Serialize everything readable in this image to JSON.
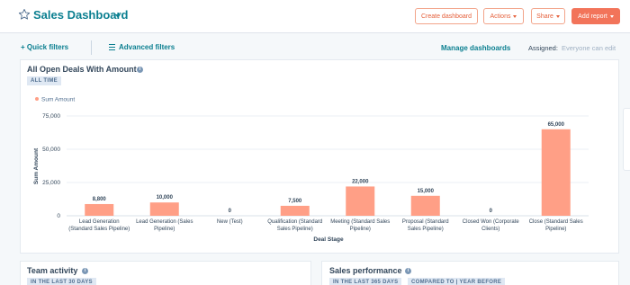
{
  "header": {
    "title": "Sales Dashboard",
    "buttons": {
      "create_dashboard": "Create dashboard",
      "actions": "Actions",
      "share": "Share",
      "add_report": "Add report"
    }
  },
  "filters": {
    "quick_filters": "+ Quick filters",
    "advanced_filters": "Advanced filters",
    "manage_dashboards": "Manage dashboards",
    "assigned_label": "Assigned:",
    "assigned_value": "Everyone can edit"
  },
  "report": {
    "title": "All Open Deals With Amount",
    "time_tag": "ALL TIME"
  },
  "chart_data": {
    "type": "bar",
    "title": "All Open Deals With Amount",
    "categories": [
      [
        "Lead Generation",
        "(Standard Sales Pipeline)"
      ],
      [
        "Lead Generation (Sales",
        "Pipeline)"
      ],
      [
        "New (Test)"
      ],
      [
        "Qualification (Standard",
        "Sales Pipeline)"
      ],
      [
        "Meeting (Standard Sales",
        "Pipeline)"
      ],
      [
        "Proposal (Standard",
        "Sales Pipeline)"
      ],
      [
        "Closed Won (Corporate",
        "Clients)"
      ],
      [
        "Close (Standard Sales",
        "Pipeline)"
      ]
    ],
    "series": [
      {
        "name": "Sum Amount",
        "values": [
          8800,
          10000,
          0,
          7500,
          22000,
          15000,
          0,
          65000
        ]
      }
    ],
    "value_labels": [
      "8,800",
      "10,000",
      "0",
      "7,500",
      "22,000",
      "15,000",
      "0",
      "65,000"
    ],
    "xlabel": "Deal Stage",
    "ylabel": "Sum Amount",
    "ylim": [
      0,
      75000
    ],
    "yticks": [
      0,
      25000,
      50000,
      75000
    ],
    "ytick_labels": [
      "0",
      "25,000",
      "50,000",
      "75,000"
    ],
    "grid": true,
    "legend": "top-left",
    "color": "#ff9f86"
  },
  "team_activity": {
    "title": "Team activity",
    "tag": "IN THE LAST 30 DAYS"
  },
  "sales_performance": {
    "title": "Sales performance",
    "tag1": "IN THE LAST 365 DAYS",
    "tag2": "COMPARED TO | YEAR BEFORE"
  },
  "icons": {
    "favorite": "star-icon",
    "info": "info-icon",
    "filter": "filter-lines-icon"
  }
}
